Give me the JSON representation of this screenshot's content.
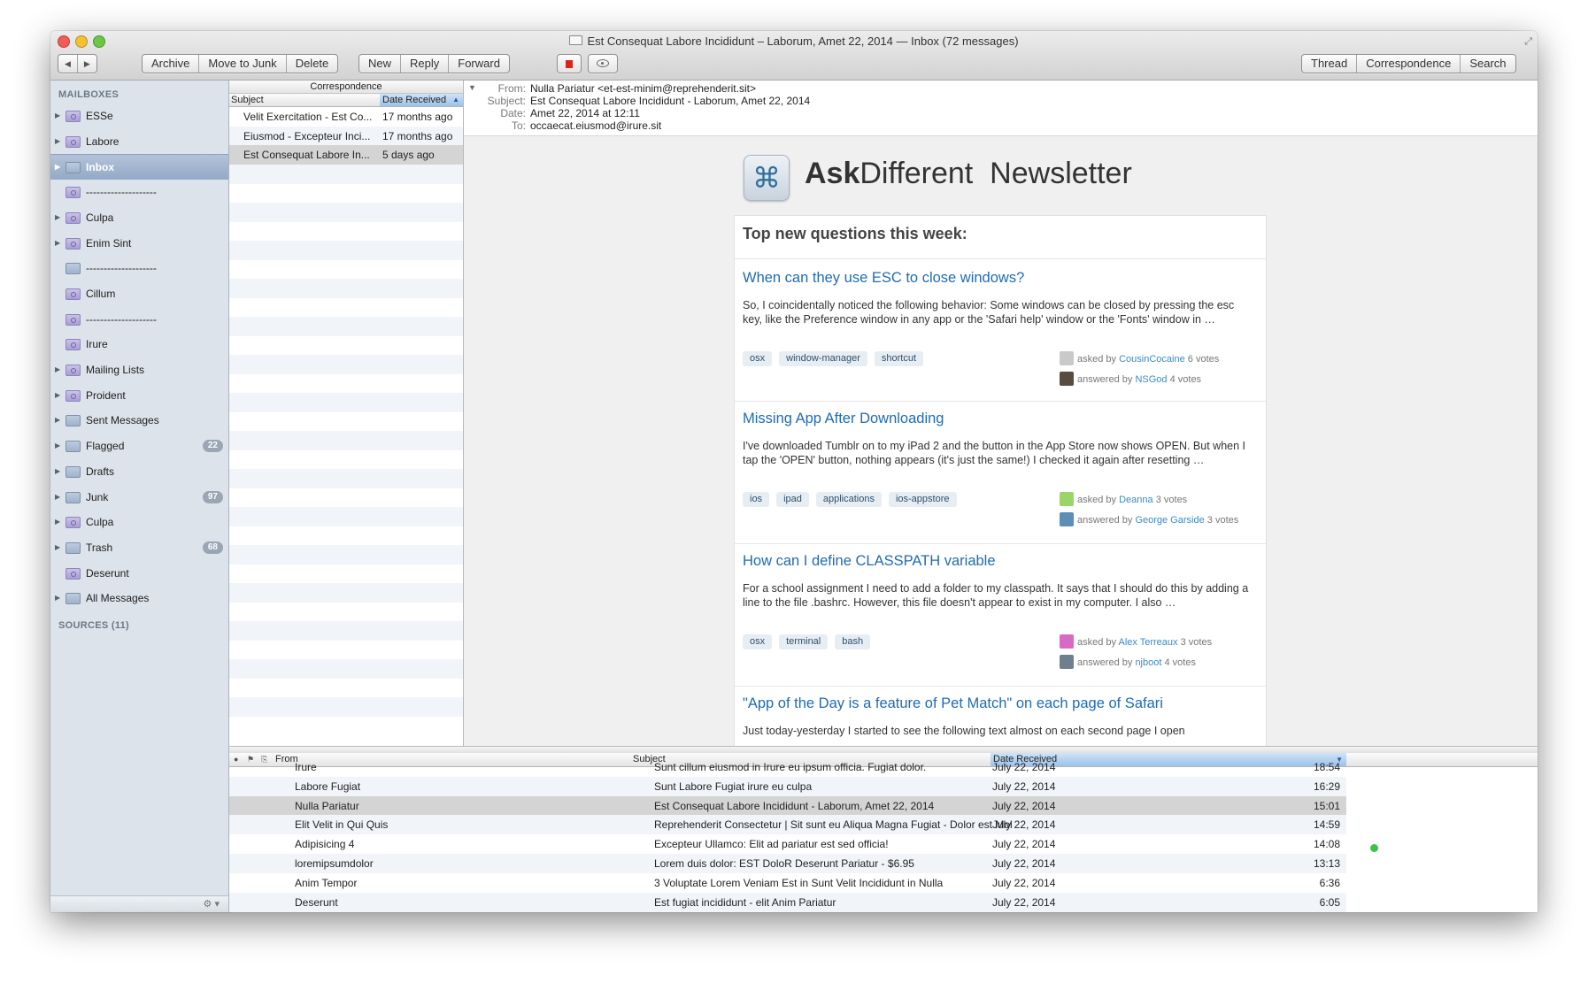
{
  "window": {
    "title": "Est Consequat Labore Incididunt – Laborum, Amet 22, 2014 — Inbox (72 messages)"
  },
  "toolbar": {
    "back": "◀",
    "forward": "▶",
    "archive": "Archive",
    "move_to_junk": "Move to Junk",
    "delete": "Delete",
    "new": "New",
    "reply": "Reply",
    "forward_label": "Forward",
    "thread": "Thread",
    "correspondence": "Correspondence",
    "search": "Search"
  },
  "sidebar": {
    "mailboxes_heading": "MAILBOXES",
    "sources_heading": "SOURCES (11)",
    "items": [
      {
        "label": "ESSe",
        "badge": "",
        "smart": true,
        "expand": true
      },
      {
        "label": "Labore",
        "badge": "",
        "smart": true,
        "expand": true
      },
      {
        "label": "Inbox",
        "badge": "",
        "smart": false,
        "expand": true,
        "selected": true
      },
      {
        "label": "--------------------",
        "badge": "",
        "smart": true,
        "expand": false
      },
      {
        "label": "Culpa",
        "badge": "",
        "smart": true,
        "expand": true
      },
      {
        "label": "Enim Sint",
        "badge": "",
        "smart": true,
        "expand": true
      },
      {
        "label": "--------------------",
        "badge": "",
        "smart": false,
        "expand": false
      },
      {
        "label": "Cillum",
        "badge": "",
        "smart": true,
        "expand": false
      },
      {
        "label": "--------------------",
        "badge": "",
        "smart": true,
        "expand": false
      },
      {
        "label": "Irure",
        "badge": "",
        "smart": true,
        "expand": false
      },
      {
        "label": "Mailing Lists",
        "badge": "",
        "smart": true,
        "expand": true
      },
      {
        "label": "Proident",
        "badge": "",
        "smart": true,
        "expand": true
      },
      {
        "label": "Sent Messages",
        "badge": "",
        "smart": false,
        "expand": true
      },
      {
        "label": "Flagged",
        "badge": "22",
        "smart": false,
        "expand": true
      },
      {
        "label": "Drafts",
        "badge": "",
        "smart": false,
        "expand": true
      },
      {
        "label": "Junk",
        "badge": "97",
        "smart": false,
        "expand": true
      },
      {
        "label": "Culpa",
        "badge": "",
        "smart": true,
        "expand": true
      },
      {
        "label": "Trash",
        "badge": "68",
        "smart": false,
        "expand": true
      },
      {
        "label": "Deserunt",
        "badge": "",
        "smart": true,
        "expand": false
      },
      {
        "label": "All Messages",
        "badge": "",
        "smart": false,
        "expand": true
      }
    ]
  },
  "message_list": {
    "group_header": "Correspondence",
    "col_subject": "Subject",
    "col_date": "Date Received",
    "rows": [
      {
        "subject": "Velit Exercitation - Est Co...",
        "date": "17 months ago"
      },
      {
        "subject": "Eiusmod - Excepteur Inci...",
        "date": "17 months ago"
      },
      {
        "subject": "Est Consequat Labore In...",
        "date": "5 days ago",
        "selected": true
      }
    ]
  },
  "headers": {
    "from_label": "From:",
    "from": "Nulla Pariatur <et-est-minim@reprehenderit.sit>",
    "subject_label": "Subject:",
    "subject": "Est Consequat Labore Incididunt - Laborum, Amet 22, 2014",
    "date_label": "Date:",
    "date": "Amet 22, 2014 at 12:11",
    "to_label": "To:",
    "to": "occaecat.eiusmod@irure.sit"
  },
  "newsletter": {
    "brand_bold": "Ask",
    "brand_rest": "Different",
    "brand_suffix": "Newsletter",
    "heading": "Top new questions this week:",
    "asked_by": "asked by",
    "answered_by": "answered by",
    "votes_suffix": "votes",
    "questions": [
      {
        "title": "When can they use ESC to close windows?",
        "excerpt": "So, I coincidentally noticed the following behavior: Some windows can be closed by pressing the esc key, like the Preference window in any app or the 'Safari help' window or the 'Fonts' window in …",
        "tags": [
          "osx",
          "window-manager",
          "shortcut"
        ],
        "asker": "CousinCocaine",
        "asker_votes": "6",
        "answerer": "NSGod",
        "answerer_votes": "4",
        "asker_color": "#c9c9c9",
        "answerer_color": "#5a4b3f"
      },
      {
        "title": "Missing App After Downloading",
        "excerpt": "I've downloaded Tumblr on to my iPad 2 and the button in the App Store now shows OPEN. But when I tap the 'OPEN' button, nothing appears (it's just the same!) I checked it again after resetting …",
        "tags": [
          "ios",
          "ipad",
          "applications",
          "ios-appstore"
        ],
        "asker": "Deanna",
        "asker_votes": "3",
        "answerer": "George Garside",
        "answerer_votes": "3",
        "asker_color": "#9bd56a",
        "answerer_color": "#5d8fb6"
      },
      {
        "title": "How can I define CLASSPATH variable",
        "excerpt": "For a school assignment I need to add a folder to my classpath. It says that I should do this by adding a line to the file .bashrc. However, this file doesn't appear to exist in my computer. I also …",
        "tags": [
          "osx",
          "terminal",
          "bash"
        ],
        "asker": "Alex Terreaux",
        "asker_votes": "3",
        "answerer": "njboot",
        "answerer_votes": "4",
        "asker_color": "#d96ac4",
        "answerer_color": "#6f7f8e"
      },
      {
        "title": "\"App of the Day is a feature of Pet Match\" on each page of Safari",
        "excerpt": "Just today-yesterday I started to see the following text almost on each second page I open",
        "tags": [],
        "asker": "",
        "asker_votes": "",
        "answerer": "",
        "answerer_votes": "",
        "asker_color": "#ccc",
        "answerer_color": "#ccc"
      }
    ]
  },
  "bottom_list": {
    "col_from": "From",
    "col_subject": "Subject",
    "col_date": "Date Received",
    "rows": [
      {
        "from": "Irure",
        "subject": "Sunt cillum eiusmod in Irure eu ipsum officia. Fugiat dolor.",
        "date": "July 22, 2014",
        "time": "18:54"
      },
      {
        "from": "Labore Fugiat",
        "subject": "Sunt Labore Fugiat irure eu culpa",
        "date": "July 22, 2014",
        "time": "16:29"
      },
      {
        "from": "Nulla Pariatur",
        "subject": "Est Consequat Labore Incididunt - Laborum, Amet 22, 2014",
        "date": "July 22, 2014",
        "time": "15:01",
        "selected": true
      },
      {
        "from": "Elit Velit in Qui Quis",
        "subject": "Reprehenderit Consectetur | Sit sunt eu Aliqua Magna Fugiat - Dolor est Mollit Pariatur",
        "date": "July 22, 2014",
        "time": "14:59"
      },
      {
        "from": "Adipisicing 4",
        "subject": "Excepteur Ullamco: Elit ad pariatur est sed officia!",
        "date": "July 22, 2014",
        "time": "14:08"
      },
      {
        "from": "loremipsumdolor",
        "subject": "Lorem duis dolor: EST DoloR Deserunt Pariatur - $6.95",
        "date": "July 22, 2014",
        "time": "13:13"
      },
      {
        "from": "Anim Tempor",
        "subject": "3 Voluptate Lorem Veniam Est in Sunt Velit Incididunt in Nulla",
        "date": "July 22, 2014",
        "time": "6:36"
      },
      {
        "from": "Deserunt",
        "subject": "Est fugiat incididunt - elit Anim Pariatur",
        "date": "July 22, 2014",
        "time": "6:05"
      }
    ]
  }
}
